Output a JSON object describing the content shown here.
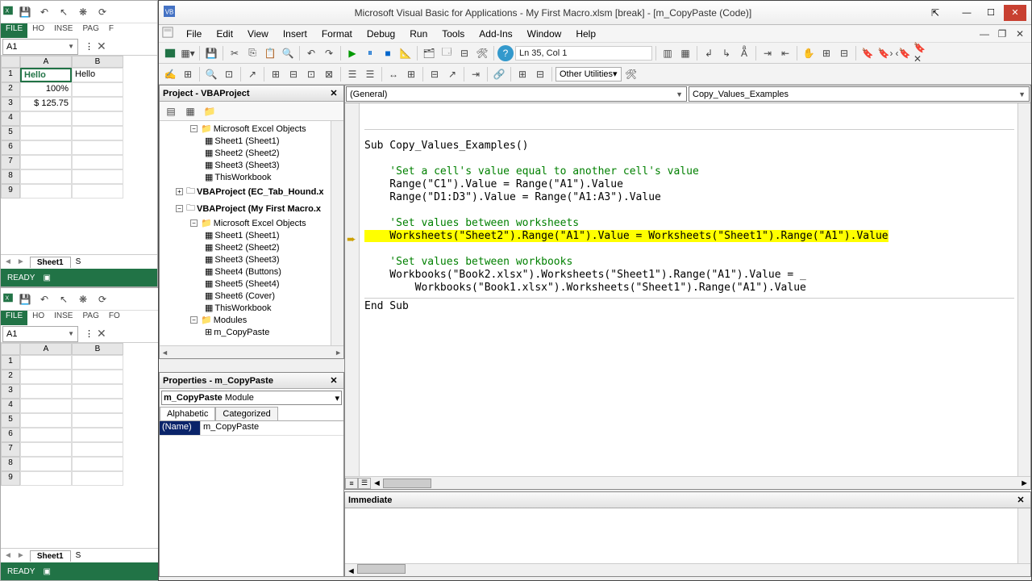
{
  "vba": {
    "title": "Microsoft Visual Basic for Applications - My First Macro.xlsm [break] - [m_CopyPaste (Code)]",
    "menu": [
      "File",
      "Edit",
      "View",
      "Insert",
      "Format",
      "Debug",
      "Run",
      "Tools",
      "Add-Ins",
      "Window",
      "Help"
    ],
    "cursor_pos": "Ln 35, Col 1",
    "other_utilities": "Other Utilities",
    "project_title": "Project - VBAProject",
    "tree": {
      "meo1": "Microsoft Excel Objects",
      "s1a": "Sheet1 (Sheet1)",
      "s2a": "Sheet2 (Sheet2)",
      "s3a": "Sheet3 (Sheet3)",
      "twa": "ThisWorkbook",
      "proj_ec": "VBAProject (EC_Tab_Hound.x",
      "proj_my": "VBAProject (My First Macro.x",
      "meo2": "Microsoft Excel Objects",
      "s1b": "Sheet1 (Sheet1)",
      "s2b": "Sheet2 (Sheet2)",
      "s3b": "Sheet3 (Sheet3)",
      "s4b": "Sheet4 (Buttons)",
      "s5b": "Sheet5 (Sheet4)",
      "s6b": "Sheet6 (Cover)",
      "twb": "ThisWorkbook",
      "modules": "Modules",
      "m_cp": "m_CopyPaste"
    },
    "properties_title": "Properties - m_CopyPaste",
    "prop_combo": "m_CopyPaste Module",
    "prop_tabs": {
      "alphabetic": "Alphabetic",
      "categorized": "Categorized"
    },
    "prop_name_key": "(Name)",
    "prop_name_val": "m_CopyPaste",
    "code_dd_left": "(General)",
    "code_dd_right": "Copy_Values_Examples",
    "immediate_title": "Immediate",
    "code": {
      "l1": "Sub Copy_Values_Examples()",
      "c1": "    'Set a cell's value equal to another cell's value",
      "l2": "    Range(\"C1\").Value = Range(\"A1\").Value",
      "l3": "    Range(\"D1:D3\").Value = Range(\"A1:A3\").Value",
      "c2": "    'Set values between worksheets",
      "hl": "    Worksheets(\"Sheet2\").Range(\"A1\").Value = Worksheets(\"Sheet1\").Range(\"A1\").Value",
      "c3": "    'Set values between workbooks",
      "l4": "    Workbooks(\"Book2.xlsx\").Worksheets(\"Sheet1\").Range(\"A1\").Value = _",
      "l5": "        Workbooks(\"Book1.xlsx\").Worksheets(\"Sheet1\").Range(\"A1\").Value",
      "l6": "End Sub"
    }
  },
  "excel1": {
    "tabs": [
      "FILE",
      "HO",
      "INSE",
      "PAG",
      "F"
    ],
    "cellref": "A1",
    "a1": "Hello",
    "b1": "Hello",
    "a2": "100%",
    "a3": "$ 125.75",
    "cols": [
      "A",
      "B"
    ],
    "sheet": "Sheet1",
    "status": "READY"
  },
  "excel2": {
    "tabs": [
      "FILE",
      "HO",
      "INSE",
      "PAG",
      "FO"
    ],
    "cellref": "A1",
    "cols": [
      "A",
      "B"
    ],
    "sheet": "Sheet1",
    "status": "READY"
  }
}
